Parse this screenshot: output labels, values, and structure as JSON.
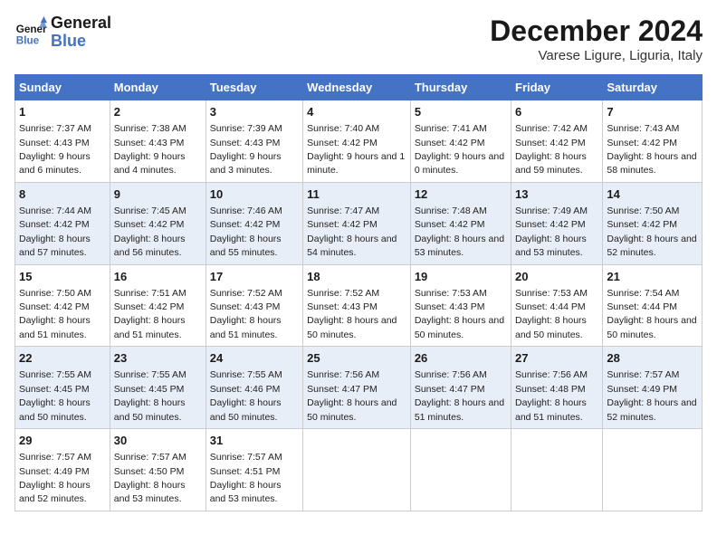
{
  "header": {
    "logo_general": "General",
    "logo_blue": "Blue",
    "title": "December 2024",
    "subtitle": "Varese Ligure, Liguria, Italy"
  },
  "days_of_week": [
    "Sunday",
    "Monday",
    "Tuesday",
    "Wednesday",
    "Thursday",
    "Friday",
    "Saturday"
  ],
  "weeks": [
    [
      {
        "day": "1",
        "sunrise": "7:37 AM",
        "sunset": "4:43 PM",
        "daylight": "9 hours and 6 minutes."
      },
      {
        "day": "2",
        "sunrise": "7:38 AM",
        "sunset": "4:43 PM",
        "daylight": "9 hours and 4 minutes."
      },
      {
        "day": "3",
        "sunrise": "7:39 AM",
        "sunset": "4:43 PM",
        "daylight": "9 hours and 3 minutes."
      },
      {
        "day": "4",
        "sunrise": "7:40 AM",
        "sunset": "4:42 PM",
        "daylight": "9 hours and 1 minute."
      },
      {
        "day": "5",
        "sunrise": "7:41 AM",
        "sunset": "4:42 PM",
        "daylight": "9 hours and 0 minutes."
      },
      {
        "day": "6",
        "sunrise": "7:42 AM",
        "sunset": "4:42 PM",
        "daylight": "8 hours and 59 minutes."
      },
      {
        "day": "7",
        "sunrise": "7:43 AM",
        "sunset": "4:42 PM",
        "daylight": "8 hours and 58 minutes."
      }
    ],
    [
      {
        "day": "8",
        "sunrise": "7:44 AM",
        "sunset": "4:42 PM",
        "daylight": "8 hours and 57 minutes."
      },
      {
        "day": "9",
        "sunrise": "7:45 AM",
        "sunset": "4:42 PM",
        "daylight": "8 hours and 56 minutes."
      },
      {
        "day": "10",
        "sunrise": "7:46 AM",
        "sunset": "4:42 PM",
        "daylight": "8 hours and 55 minutes."
      },
      {
        "day": "11",
        "sunrise": "7:47 AM",
        "sunset": "4:42 PM",
        "daylight": "8 hours and 54 minutes."
      },
      {
        "day": "12",
        "sunrise": "7:48 AM",
        "sunset": "4:42 PM",
        "daylight": "8 hours and 53 minutes."
      },
      {
        "day": "13",
        "sunrise": "7:49 AM",
        "sunset": "4:42 PM",
        "daylight": "8 hours and 53 minutes."
      },
      {
        "day": "14",
        "sunrise": "7:50 AM",
        "sunset": "4:42 PM",
        "daylight": "8 hours and 52 minutes."
      }
    ],
    [
      {
        "day": "15",
        "sunrise": "7:50 AM",
        "sunset": "4:42 PM",
        "daylight": "8 hours and 51 minutes."
      },
      {
        "day": "16",
        "sunrise": "7:51 AM",
        "sunset": "4:42 PM",
        "daylight": "8 hours and 51 minutes."
      },
      {
        "day": "17",
        "sunrise": "7:52 AM",
        "sunset": "4:43 PM",
        "daylight": "8 hours and 51 minutes."
      },
      {
        "day": "18",
        "sunrise": "7:52 AM",
        "sunset": "4:43 PM",
        "daylight": "8 hours and 50 minutes."
      },
      {
        "day": "19",
        "sunrise": "7:53 AM",
        "sunset": "4:43 PM",
        "daylight": "8 hours and 50 minutes."
      },
      {
        "day": "20",
        "sunrise": "7:53 AM",
        "sunset": "4:44 PM",
        "daylight": "8 hours and 50 minutes."
      },
      {
        "day": "21",
        "sunrise": "7:54 AM",
        "sunset": "4:44 PM",
        "daylight": "8 hours and 50 minutes."
      }
    ],
    [
      {
        "day": "22",
        "sunrise": "7:55 AM",
        "sunset": "4:45 PM",
        "daylight": "8 hours and 50 minutes."
      },
      {
        "day": "23",
        "sunrise": "7:55 AM",
        "sunset": "4:45 PM",
        "daylight": "8 hours and 50 minutes."
      },
      {
        "day": "24",
        "sunrise": "7:55 AM",
        "sunset": "4:46 PM",
        "daylight": "8 hours and 50 minutes."
      },
      {
        "day": "25",
        "sunrise": "7:56 AM",
        "sunset": "4:47 PM",
        "daylight": "8 hours and 50 minutes."
      },
      {
        "day": "26",
        "sunrise": "7:56 AM",
        "sunset": "4:47 PM",
        "daylight": "8 hours and 51 minutes."
      },
      {
        "day": "27",
        "sunrise": "7:56 AM",
        "sunset": "4:48 PM",
        "daylight": "8 hours and 51 minutes."
      },
      {
        "day": "28",
        "sunrise": "7:57 AM",
        "sunset": "4:49 PM",
        "daylight": "8 hours and 52 minutes."
      }
    ],
    [
      {
        "day": "29",
        "sunrise": "7:57 AM",
        "sunset": "4:49 PM",
        "daylight": "8 hours and 52 minutes."
      },
      {
        "day": "30",
        "sunrise": "7:57 AM",
        "sunset": "4:50 PM",
        "daylight": "8 hours and 53 minutes."
      },
      {
        "day": "31",
        "sunrise": "7:57 AM",
        "sunset": "4:51 PM",
        "daylight": "8 hours and 53 minutes."
      },
      null,
      null,
      null,
      null
    ]
  ],
  "labels": {
    "sunrise": "Sunrise:",
    "sunset": "Sunset:",
    "daylight": "Daylight:"
  }
}
